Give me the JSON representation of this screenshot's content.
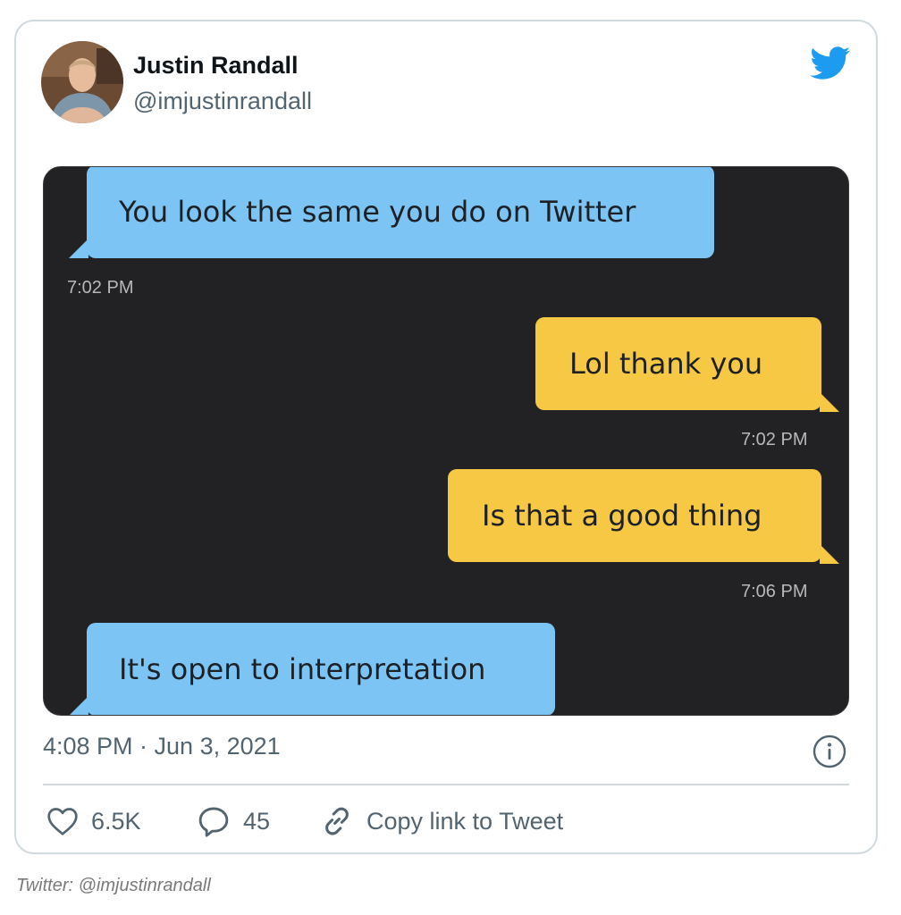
{
  "tweet": {
    "author_name": "Justin Randall",
    "author_handle": "@imjustinrandall",
    "timestamp": "4:08 PM · Jun 3, 2021",
    "likes": "6.5K",
    "replies": "45",
    "copy_link_label": "Copy link to Tweet"
  },
  "chat": {
    "messages": [
      {
        "text": "You look the same you do on Twitter",
        "time": "7:02 PM",
        "side": "incoming"
      },
      {
        "text": "Lol thank you",
        "time": "7:02 PM",
        "side": "outgoing"
      },
      {
        "text": "Is that a good thing",
        "time": "7:06 PM",
        "side": "outgoing"
      },
      {
        "text": "It's open to interpretation",
        "side": "incoming"
      }
    ]
  },
  "caption": "Twitter: @imjustinrandall",
  "colors": {
    "incoming_bubble": "#7cc4f3",
    "outgoing_bubble": "#f6c844",
    "chat_background": "#222224",
    "twitter_blue": "#1d9bf0"
  },
  "icons": [
    "avatar",
    "twitter-bird-icon",
    "info-icon",
    "heart-icon",
    "reply-icon",
    "link-icon"
  ]
}
